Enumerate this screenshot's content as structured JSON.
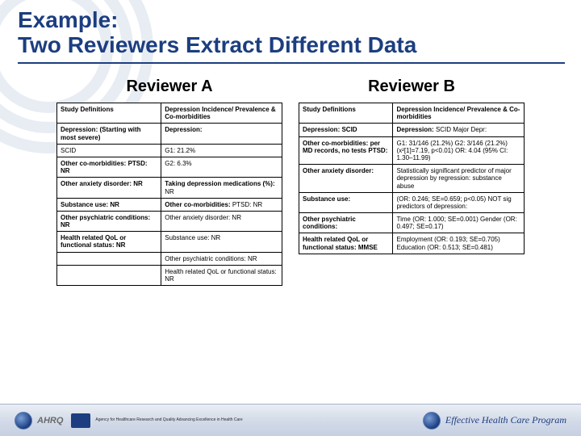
{
  "title": {
    "line1": "Example:",
    "line2": "Two Reviewers Extract Different Data"
  },
  "columns": {
    "a": {
      "heading": "Reviewer A",
      "headers": [
        "Study Definitions",
        "Depression Incidence/ Prevalence & Co-morbidities"
      ],
      "rows": [
        [
          "Depression: (Starting with most severe)",
          "Depression:"
        ],
        [
          "SCID",
          "G1: 21.2%"
        ],
        [
          "Other co-morbidities: PTSD: NR",
          "G2: 6.3%"
        ],
        [
          "Other anxiety disorder: NR",
          "Taking depression medications (%): NR"
        ],
        [
          "Substance use: NR",
          "Other co-morbidities: PTSD: NR"
        ],
        [
          "Other psychiatric conditions: NR",
          "Other anxiety disorder: NR"
        ],
        [
          "Health related QoL or functional status: NR",
          "Substance use: NR"
        ],
        [
          "",
          "Other psychiatric conditions: NR"
        ],
        [
          "",
          "Health related QoL or functional status: NR"
        ]
      ],
      "boldLeft": [
        0,
        2,
        3,
        4,
        5,
        6
      ],
      "boldRightPrefix": {
        "0": "Depression:",
        "3": "Taking depression medications (%):",
        "4": "Other co-morbidities:"
      }
    },
    "b": {
      "heading": "Reviewer B",
      "headers": [
        "Study Definitions",
        "Depression Incidence/ Prevalence & Co-morbidities"
      ],
      "rows": [
        [
          "Depression: SCID",
          "Depression: SCID Major Depr:"
        ],
        [
          "Other co-morbidities: per MD records, no tests PTSD:",
          "G1: 31/146 (21.2%) G2: 3/146 (21.2%) (x²[1]=7.19, p<0.01) OR: 4.04 (95% CI: 1.30–11.99)"
        ],
        [
          "Other anxiety disorder:",
          "Statistically significant predictor of major depression by regression: substance abuse"
        ],
        [
          "Substance use:",
          "(OR: 0.246; SE=0.659; p<0.05) NOT sig predictors of depression:"
        ],
        [
          "Other psychiatric conditions:",
          "Time (OR: 1.000; SE=0.001) Gender (OR: 0.497; SE=0.17)"
        ],
        [
          "Health related QoL or functional status: MMSE",
          "Employment (OR: 0.193; SE=0.705) Education (OR: 0.513; SE=0.481)"
        ]
      ],
      "boldLeft": [
        0,
        1,
        2,
        3,
        4,
        5
      ],
      "boldRightPrefix": {
        "0": "Depression:"
      }
    }
  },
  "footer": {
    "left_brand": "AHRQ",
    "left_sub": "Agency for Healthcare Research and Quality\nAdvancing Excellence in Health Care",
    "right_label": "Effective Health Care Program"
  }
}
